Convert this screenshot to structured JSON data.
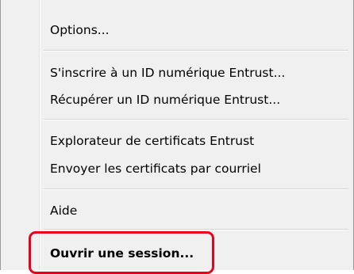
{
  "menu": {
    "items": [
      {
        "label": "Options..."
      },
      {
        "label": "S'inscrire à un ID numérique Entrust..."
      },
      {
        "label": "Récupérer un ID numérique Entrust..."
      },
      {
        "label": "Explorateur de certificats Entrust"
      },
      {
        "label": "Envoyer les certificats par courriel"
      },
      {
        "label": "Aide"
      },
      {
        "label": "Ouvrir une session..."
      }
    ]
  },
  "colors": {
    "menu_background": "#f0f0f0",
    "highlight_outline": "#e8001c"
  }
}
